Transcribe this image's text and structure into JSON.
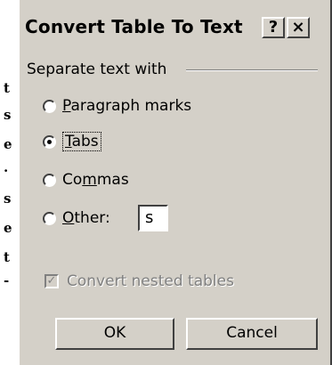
{
  "dialog": {
    "title": "Convert Table To Text",
    "help_glyph": "?",
    "close_glyph": "×"
  },
  "separate": {
    "group_label": "Separate text with",
    "options": [
      {
        "pre": "",
        "u": "P",
        "post": "aragraph marks",
        "checked": false
      },
      {
        "pre": "",
        "u": "T",
        "post": "abs",
        "checked": true
      },
      {
        "pre": "Co",
        "u": "m",
        "post": "mas",
        "checked": false
      },
      {
        "pre": "",
        "u": "O",
        "post": "ther:",
        "checked": false
      }
    ],
    "other_value": "s"
  },
  "nested": {
    "label": "Convert nested tables",
    "checked": true,
    "enabled": false
  },
  "buttons": {
    "ok": "OK",
    "cancel": "Cancel"
  },
  "background_doc_chars": [
    "t",
    "s",
    "e",
    ".",
    "s",
    "e",
    "t",
    "-"
  ]
}
